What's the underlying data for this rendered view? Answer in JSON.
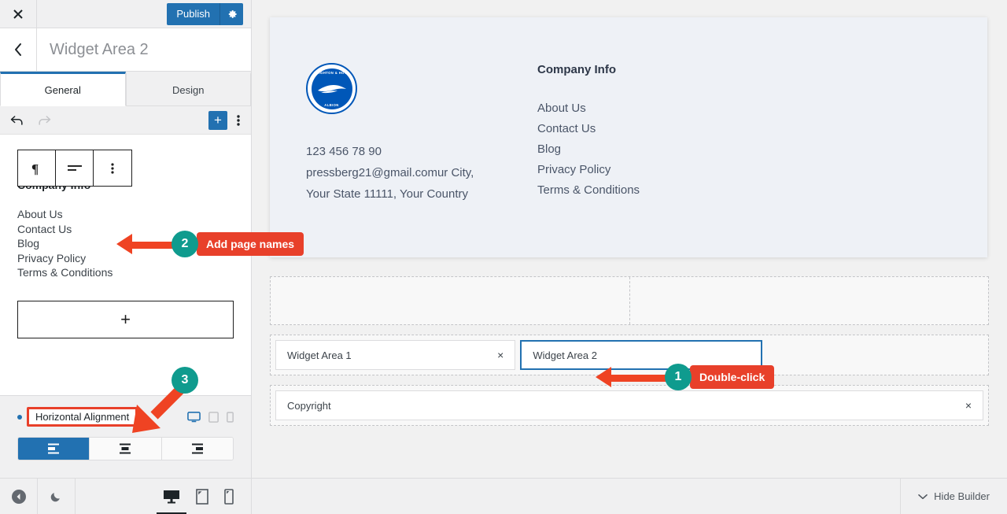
{
  "app": {
    "close_icon": "close-icon",
    "publish_label": "Publish",
    "gear_icon": "gear-icon",
    "back_icon": "chevron-left-icon",
    "panel_title": "Widget Area 2"
  },
  "tabs": [
    {
      "label": "General",
      "active": true
    },
    {
      "label": "Design",
      "active": false
    }
  ],
  "editor_toolbar": {
    "undo_icon": "undo-icon",
    "redo_icon": "redo-icon",
    "add_block_label": "+",
    "options_icon": "kebab-menu-icon"
  },
  "block_toolbar": {
    "paragraph_icon": "paragraph-icon",
    "align_icon": "align-left-icon",
    "more_icon": "kebab-menu-icon"
  },
  "editor_content": {
    "heading": "Company Info",
    "links": [
      "About Us",
      "Contact Us",
      "Blog",
      "Privacy Policy",
      "Terms & Conditions"
    ],
    "add_block_plus": "+"
  },
  "inspector": {
    "label": "Horizontal Alignment",
    "devices": [
      {
        "name": "desktop-icon",
        "active": true
      },
      {
        "name": "tablet-icon",
        "active": false
      },
      {
        "name": "mobile-icon",
        "active": false
      }
    ],
    "alignment_options": [
      {
        "name": "align-left-icon",
        "active": true
      },
      {
        "name": "align-center-icon",
        "active": false
      },
      {
        "name": "align-right-icon",
        "active": false
      }
    ]
  },
  "left_footer": {
    "collapse_icon": "collapse-sidebar-icon",
    "dark_mode_icon": "moon-icon",
    "devices": [
      {
        "name": "desktop-preview-icon",
        "active": true
      },
      {
        "name": "tablet-preview-icon",
        "active": false
      },
      {
        "name": "mobile-preview-icon",
        "active": false
      }
    ]
  },
  "preview": {
    "logo": {
      "name": "brighton-hove-albion-logo",
      "arc_top": "BRIGHTON & HOVE",
      "arc_bottom": "ALBION"
    },
    "contact": [
      "123 456 78 90",
      "pressberg21@gmail.comur City,",
      "Your State 11111, Your Country"
    ],
    "column_heading": "Company Info",
    "links": [
      "About Us",
      "Contact Us",
      "Blog",
      "Privacy Policy",
      "Terms & Conditions"
    ]
  },
  "builder": {
    "empty_row_columns": 2,
    "widget_row": [
      {
        "label": "Widget Area 1",
        "selected": false,
        "close_icon": "×"
      },
      {
        "label": "Widget Area 2",
        "selected": true,
        "close_icon": "×"
      }
    ],
    "copyright_row": [
      {
        "label": "Copyright",
        "selected": false,
        "close_icon": "×"
      }
    ]
  },
  "right_footer": {
    "hide_builder_label": "Hide Builder",
    "chevron_icon": "chevron-down-icon"
  },
  "callouts": [
    {
      "number": "1",
      "label": "Double-click"
    },
    {
      "number": "2",
      "label": "Add page names"
    },
    {
      "number": "3",
      "label": ""
    }
  ],
  "colors": {
    "accent_blue": "#2271b1",
    "callout_red": "#e8402a",
    "callout_teal": "#0f9b8e",
    "logo_blue": "#0057b8"
  }
}
